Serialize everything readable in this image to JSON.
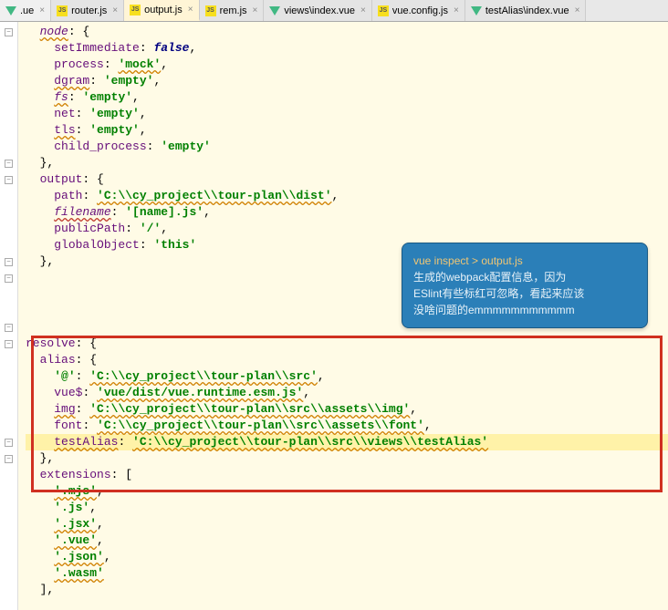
{
  "tabs": [
    {
      "label": ".ue",
      "icon": "vue",
      "active": false
    },
    {
      "label": "router.js",
      "icon": "js",
      "active": false
    },
    {
      "label": "output.js",
      "icon": "js",
      "active": true
    },
    {
      "label": "rem.js",
      "icon": "js",
      "active": false
    },
    {
      "label": "views\\index.vue",
      "icon": "vue",
      "active": false
    },
    {
      "label": "vue.config.js",
      "icon": "js",
      "active": false
    },
    {
      "label": "testAlias\\index.vue",
      "icon": "vue",
      "active": false
    }
  ],
  "callout": {
    "cmd": "vue inspect > output.js",
    "line1": "生成的webpack配置信息，因为",
    "line2": "ESlint有些标红可忽略，看起来应该",
    "line3": "没啥问题的emmmmmmmmmmm"
  },
  "code": {
    "node": {
      "key": "node",
      "setImmediate_k": "setImmediate",
      "setImmediate_v": "false",
      "process_k": "process",
      "process_v": "'mock'",
      "dgram_k": "dgram",
      "dgram_v": "'empty'",
      "fs_k": "fs",
      "fs_v": "'empty'",
      "net_k": "net",
      "net_v": "'empty'",
      "tls_k": "tls",
      "tls_v": "'empty'",
      "child_k": "child_process",
      "child_v": "'empty'"
    },
    "output": {
      "key": "output",
      "path_k": "path",
      "path_v": "'C:\\\\cy_project\\\\tour-plan\\\\dist'",
      "filename_k": "filename",
      "filename_v": "'[name].js'",
      "publicPath_k": "publicPath",
      "publicPath_v": "'/'",
      "globalObject_k": "globalObject",
      "globalObject_v": "'this'"
    },
    "resolve": {
      "key": "resolve",
      "alias_k": "alias",
      "at_k": "'@'",
      "at_v": "'C:\\\\cy_project\\\\tour-plan\\\\src'",
      "vue_k": "vue$",
      "vue_v": "'vue/dist/vue.runtime.esm.js'",
      "img_k": "img",
      "img_v": "'C:\\\\cy_project\\\\tour-plan\\\\src\\\\assets\\\\img'",
      "font_k": "font",
      "font_v": "'C:\\\\cy_project\\\\tour-plan\\\\src\\\\assets\\\\font'",
      "testAlias_k": "testAlias",
      "testAlias_v": "'C:\\\\cy_project\\\\tour-plan\\\\src\\\\views\\\\testAlias'",
      "extensions_k": "extensions",
      "ext": [
        "'.mjs'",
        "'.js'",
        "'.jsx'",
        "'.vue'",
        "'.json'",
        "'.wasm'"
      ]
    }
  }
}
